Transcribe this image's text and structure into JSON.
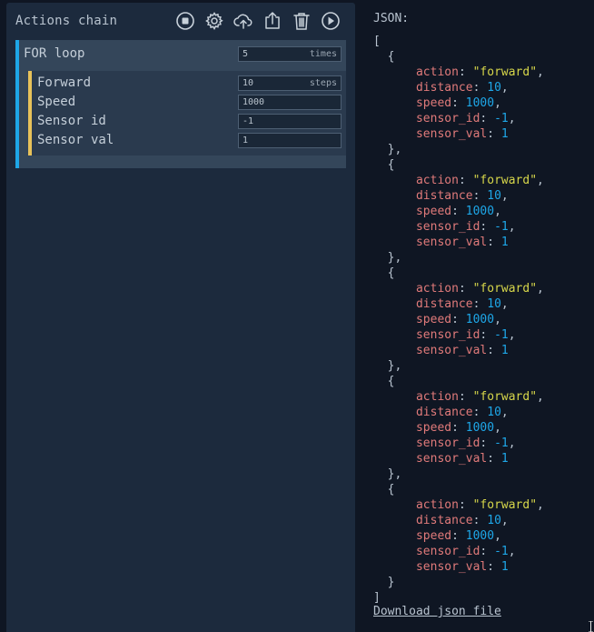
{
  "chain": {
    "title": "Actions chain",
    "toolbar": [
      {
        "icon": "stop-icon"
      },
      {
        "icon": "gear-icon"
      },
      {
        "icon": "cloud-upload-icon"
      },
      {
        "icon": "export-icon"
      },
      {
        "icon": "trash-icon"
      },
      {
        "icon": "play-icon"
      }
    ],
    "for_loop": {
      "label": "FOR loop",
      "count": "5",
      "count_unit": "times",
      "action": {
        "forward_label": "Forward",
        "forward_value": "10",
        "forward_unit": "steps",
        "speed_label": "Speed",
        "speed_value": "1000",
        "sensor_id_label": "Sensor id",
        "sensor_id_value": "-1",
        "sensor_val_label": "Sensor val",
        "sensor_val_value": "1"
      }
    }
  },
  "json_panel": {
    "label": "JSON:",
    "items": [
      {
        "action": "\"forward\"",
        "distance": "10",
        "speed": "1000",
        "sensor_id": "-1",
        "sensor_val": "1"
      },
      {
        "action": "\"forward\"",
        "distance": "10",
        "speed": "1000",
        "sensor_id": "-1",
        "sensor_val": "1"
      },
      {
        "action": "\"forward\"",
        "distance": "10",
        "speed": "1000",
        "sensor_id": "-1",
        "sensor_val": "1"
      },
      {
        "action": "\"forward\"",
        "distance": "10",
        "speed": "1000",
        "sensor_id": "-1",
        "sensor_val": "1"
      },
      {
        "action": "\"forward\"",
        "distance": "10",
        "speed": "1000",
        "sensor_id": "-1",
        "sensor_val": "1"
      }
    ],
    "download_label": "Download json file"
  },
  "colors": {
    "background": "#0f1623",
    "panel": "#1c2a3d",
    "loop_accent": "#1ea7e8",
    "action_accent": "#e8c25a",
    "json_key": "#e07a7a",
    "json_string": "#d6d64a",
    "json_number": "#1ea7e8"
  }
}
